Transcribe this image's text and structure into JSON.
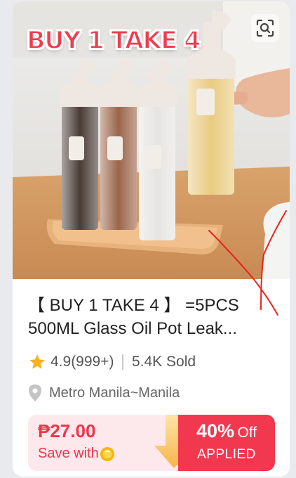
{
  "product": {
    "image_alt": "Glass oil dispenser bottles",
    "promo_text": "BUY 1 TAKE 4",
    "title_line1": "【 BUY 1 TAKE 4 】 =5PCS",
    "title_line2": "500ML Glass Oil Pot Leak...",
    "rating": "4.9(999+)",
    "sold": "5.4K Sold",
    "location": "Metro Manila~Manila"
  },
  "price_box": {
    "price": "₱27.00",
    "save_with": "Save with",
    "discount_pct": "40%",
    "discount_off": "Off",
    "applied": "APPLIED"
  },
  "icons": {
    "zoom": "image-search-icon",
    "star": "star-icon",
    "pin": "location-pin-icon",
    "coin": "coin-icon",
    "arrow": "down-arrow-icon"
  },
  "colors": {
    "accent": "#f0354c",
    "star": "#f5b120",
    "price_bg": "#fde9ec",
    "annotation": "#e8231f"
  }
}
